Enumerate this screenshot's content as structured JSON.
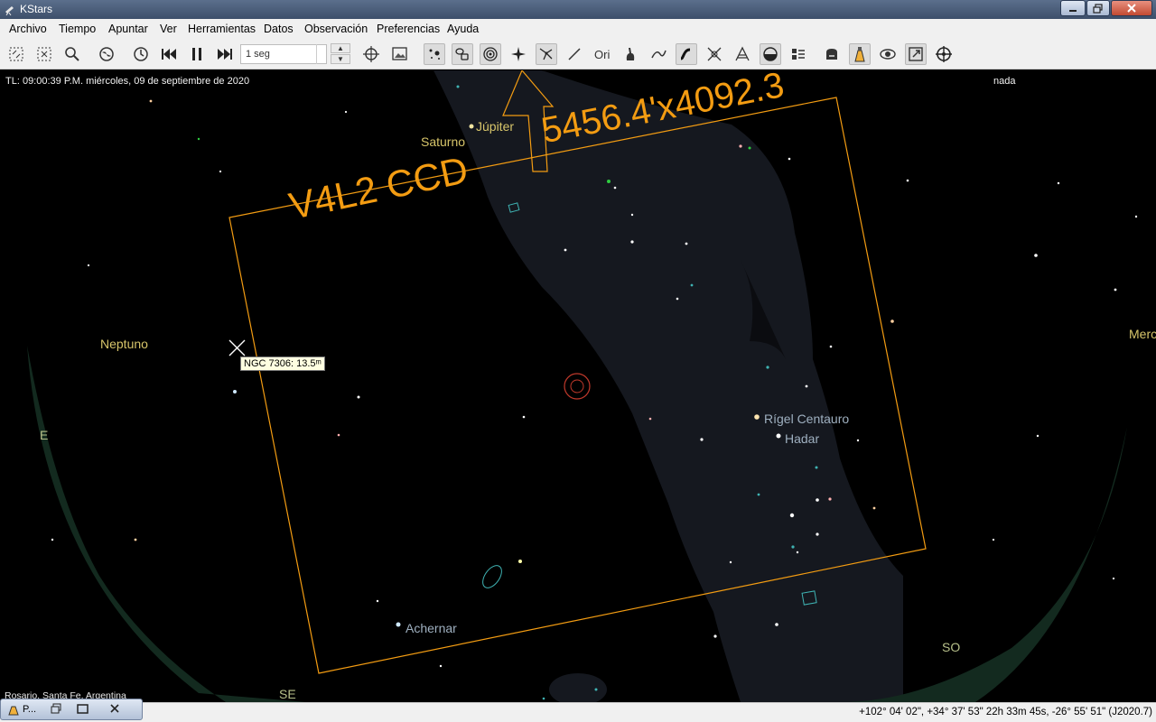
{
  "window": {
    "title": "KStars",
    "app_icon": "kstars-telescope-icon",
    "accent": "#f39c12"
  },
  "menu": {
    "items": [
      {
        "label": "Archivo",
        "mnemonic": "A"
      },
      {
        "label": "Tiempo",
        "mnemonic": "i"
      },
      {
        "label": "Apuntar",
        "mnemonic": "p"
      },
      {
        "label": "Ver",
        "mnemonic": "V"
      },
      {
        "label": "Herramientas",
        "mnemonic": "H"
      },
      {
        "label": "Datos",
        "mnemonic": "D"
      },
      {
        "label": "Observación",
        "mnemonic": "O"
      },
      {
        "label": "Preferencias",
        "mnemonic": "P"
      },
      {
        "label": "Ayuda",
        "mnemonic": "y"
      }
    ]
  },
  "toolbar": {
    "time_step": "1 seg",
    "buttons": [
      "zoom-box-icon",
      "zoom-fit-icon",
      "search-icon",
      "globe-icon",
      "clock-icon",
      "skip-backward-icon",
      "pause-icon",
      "skip-forward-icon",
      "equatorial-grid-icon",
      "image-icon",
      "stars-icon",
      "deep-sky-icon",
      "planets-icon",
      "comets-icon",
      "constellation-lines-icon",
      "constellation-art-icon",
      "constellation-names-icon",
      "milky-way-icon",
      "milky-way-curve-icon",
      "equator-icon",
      "horizon-icon",
      "ground-icon",
      "hips-icon",
      "satellites-icon",
      "supernovae-icon",
      "telescope-fov-icon",
      "eyepiece-icon",
      "export-icon",
      "crosshair-icon"
    ]
  },
  "sky": {
    "time_label": "TL: 09:00:39 P.M.   miércoles, 09 de septiembre de 2020",
    "focus_label": "nada",
    "fov_name": "V4L2 CCD",
    "fov_size": "5456.4'x4092.3",
    "tooltip": "NGC 7306: 13.5ᵐ",
    "location": "Rosario, Santa Fe, Argentina",
    "objects": {
      "jupiter": "Júpiter",
      "saturn": "Saturno",
      "neptune": "Neptuno",
      "mercury": "Merc",
      "rigel_centauro": "Rígel Centauro",
      "hadar": "Hadar",
      "achernar": "Achernar"
    },
    "compass": {
      "east": "E",
      "southeast": "SE",
      "southwest": "SO"
    }
  },
  "status": {
    "coordinates": "+102° 04' 02\", +34° 37' 53\"  22h 33m 45s, -26° 55' 51\" (J2020.7)"
  },
  "taskbar": {
    "app_label": "P..."
  }
}
